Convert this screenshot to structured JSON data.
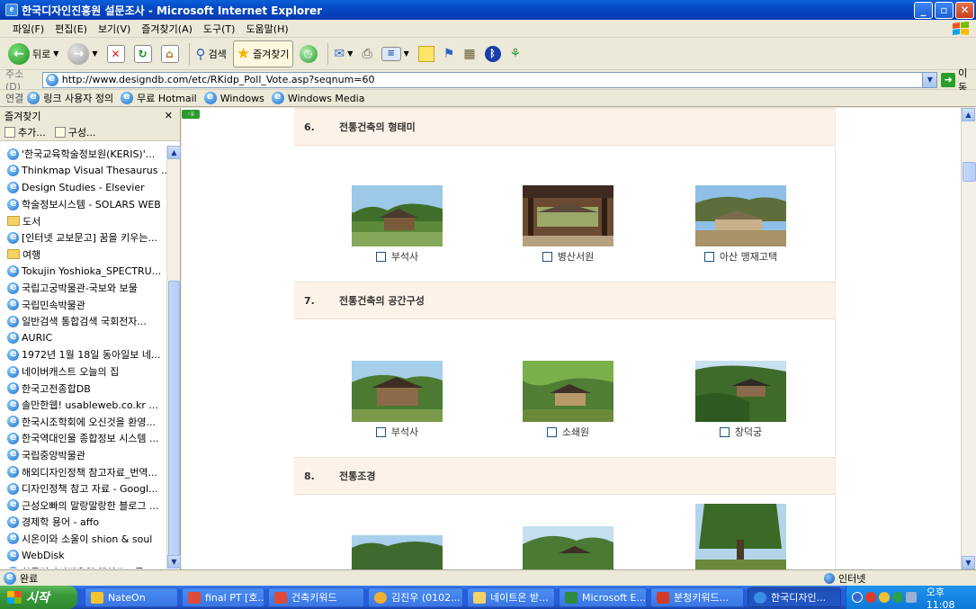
{
  "window": {
    "title": "한국디자인진흥원 설문조사 - Microsoft Internet Explorer",
    "buttons": [
      "minimize",
      "maximize",
      "close"
    ]
  },
  "menu": [
    "파일(F)",
    "편집(E)",
    "보기(V)",
    "즐겨찾기(A)",
    "도구(T)",
    "도움말(H)"
  ],
  "toolbar": {
    "back_label": "뒤로",
    "search_label": "검색",
    "favorites_label": "즐겨찾기"
  },
  "address": {
    "label": "주소(D)",
    "url": "http://www.designdb.com/etc/RKidp_Poll_Vote.asp?seqnum=60",
    "go_label": "이동"
  },
  "links": {
    "label": "연결",
    "items": [
      "링크 사용자 정의",
      "무료 Hotmail",
      "Windows",
      "Windows Media"
    ]
  },
  "favorites": {
    "header": "즐겨찾기",
    "add_label": "추가...",
    "organize_label": "구성...",
    "items": [
      {
        "label": "'한국교육학술정보원(KERIS)'...",
        "type": "link"
      },
      {
        "label": "Thinkmap Visual Thesaurus ...",
        "type": "link"
      },
      {
        "label": "Design Studies - Elsevier",
        "type": "link"
      },
      {
        "label": "학술정보시스템 - SOLARS WEB",
        "type": "link"
      },
      {
        "label": "도서",
        "type": "folder"
      },
      {
        "label": "[인터넷 교보문고] 꿈을 키우는...",
        "type": "link"
      },
      {
        "label": "여행",
        "type": "folder"
      },
      {
        "label": "Tokujin Yoshioka_SPECTRU...",
        "type": "link"
      },
      {
        "label": "국립고궁박물관-국보와 보물",
        "type": "link"
      },
      {
        "label": "국립민속박물관",
        "type": "link"
      },
      {
        "label": "일반검색 통합검색 국회전자...",
        "type": "link"
      },
      {
        "label": "AURIC",
        "type": "link"
      },
      {
        "label": "1972년 1월 18일 동아일보 네...",
        "type": "link"
      },
      {
        "label": "네이버캐스트 오늘의 집",
        "type": "link"
      },
      {
        "label": "한국고전종합DB",
        "type": "link"
      },
      {
        "label": "솔만한웹! usableweb.co.kr ...",
        "type": "link"
      },
      {
        "label": "한국시조학회에 오신것을 환영...",
        "type": "link"
      },
      {
        "label": "한국역대인물 종합정보 시스템 ...",
        "type": "link"
      },
      {
        "label": "국립중앙박물관",
        "type": "link"
      },
      {
        "label": "해외디자인정책 참고자료_번역...",
        "type": "link"
      },
      {
        "label": "디자인정책 참고 자료 - Googl...",
        "type": "link"
      },
      {
        "label": "근성오빠의 말랑말랑한 블로그 ...",
        "type": "link"
      },
      {
        "label": "경제학 용어 - affo",
        "type": "link"
      },
      {
        "label": "시온이와 소울이 shion & soul",
        "type": "link"
      },
      {
        "label": "WebDisk",
        "type": "link"
      },
      {
        "label": "한국디자인진흥원 웹하드 - 국...",
        "type": "link"
      },
      {
        "label": "http--cfile2.uf.tistory.com-me...",
        "type": "link"
      },
      {
        "label": "한국디자인진흥원 설문조사",
        "type": "link",
        "selected": true
      }
    ]
  },
  "survey": {
    "questions": [
      {
        "num": "6.",
        "title": "전통건축의 형태미",
        "options": [
          "부석사",
          "병산서원",
          "아산 맹재고택"
        ]
      },
      {
        "num": "7.",
        "title": "전통건축의 공간구성",
        "options": [
          "부석사",
          "소쇄원",
          "창덕궁"
        ]
      },
      {
        "num": "8.",
        "title": "전통조경",
        "options": []
      }
    ]
  },
  "status": {
    "text": "완료",
    "zone": "인터넷"
  },
  "taskbar": {
    "start_label": "시작",
    "tasks": [
      "NateOn",
      "final PT [호...",
      "건축키워드",
      "김진우 (0102...",
      "네이트온 받...",
      "Microsoft E...",
      "분청키워드...",
      "한국디자인..."
    ],
    "clock": "오후 11:08"
  },
  "colors": {
    "question_header_bg": "#fcf2e8",
    "titlebar": "#0449c4",
    "taskbar": "#245edb",
    "start": "#3a9a3a"
  }
}
